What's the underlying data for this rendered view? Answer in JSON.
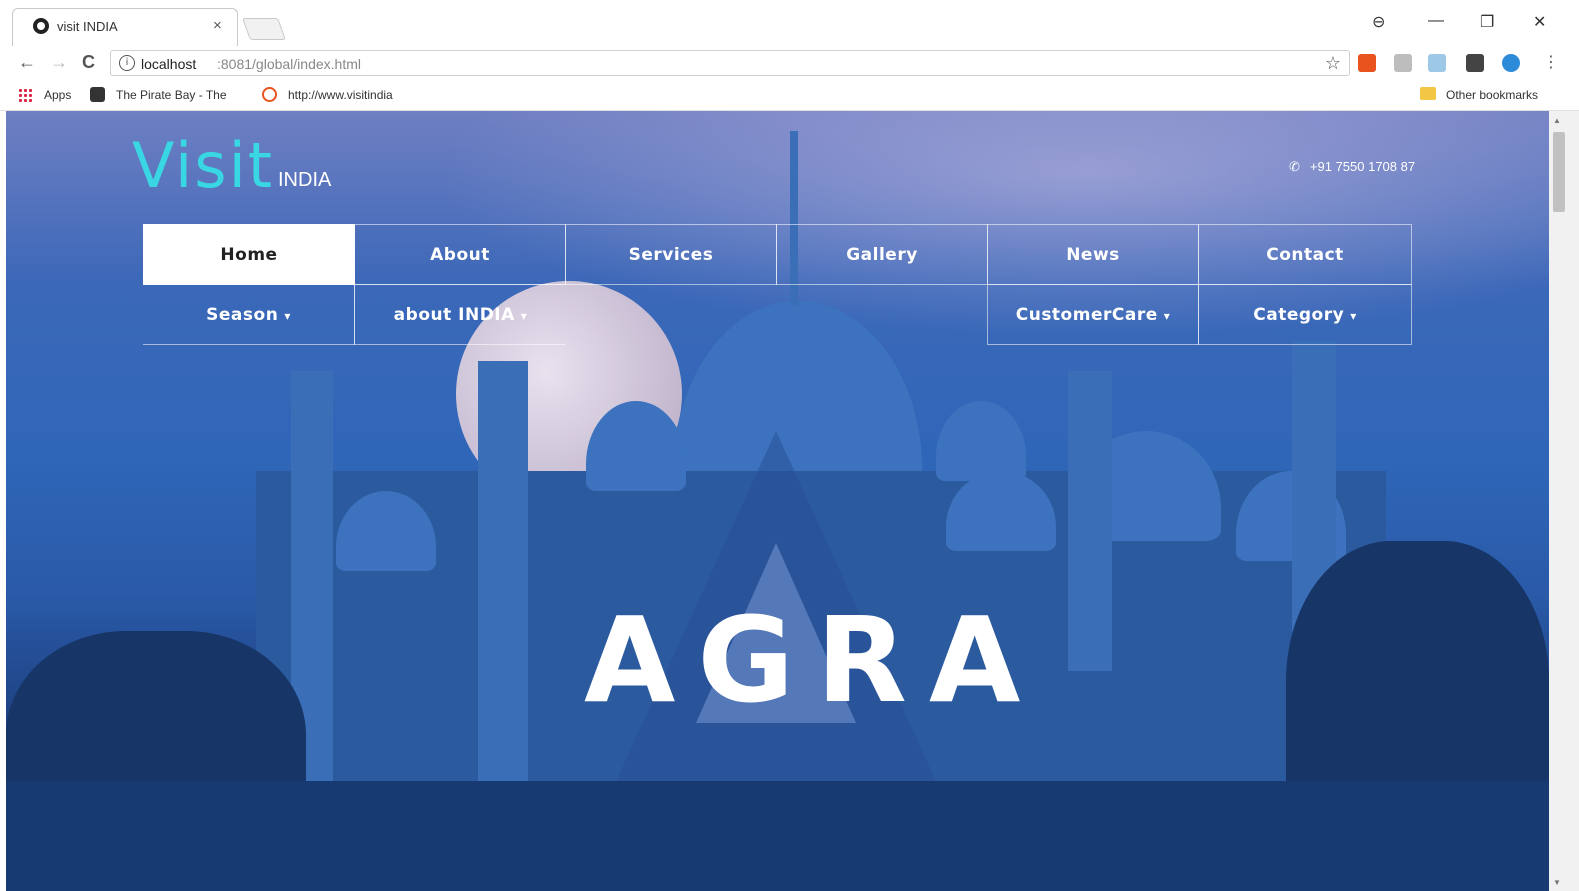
{
  "browser": {
    "tab_title": "visit INDIA",
    "tab_close": "×",
    "window_controls": {
      "account": "⊖",
      "minimize": "—",
      "restore": "❐",
      "close": "✕"
    },
    "nav": {
      "back": "←",
      "forward": "→",
      "reload": "C"
    },
    "url_host": "localhost",
    "url_path": ":8081/global/index.html",
    "star": "☆",
    "menu": "⋮",
    "bookmarks": {
      "apps": "Apps",
      "items": [
        "The Pirate Bay - The",
        "http://www.visitindia"
      ],
      "other": "Other bookmarks"
    }
  },
  "site": {
    "logo": {
      "visit": "Visit",
      "india": "INDIA"
    },
    "phone": "+91 7550 1708 87",
    "phone_icon": "phone-icon",
    "nav_row1": [
      "Home",
      "About",
      "Services",
      "Gallery",
      "News",
      "Contact"
    ],
    "nav_row2": [
      {
        "label": "Season",
        "caret": "▾"
      },
      {
        "label": "about INDIA",
        "caret": "▾"
      },
      {
        "label": "CustomerCare",
        "caret": "▾"
      },
      {
        "label": "Category",
        "caret": "▾"
      }
    ],
    "active_item": "Home",
    "hero_title": "AGRA"
  },
  "colors": {
    "logo_accent": "#39d7e3",
    "sky": "#2f66b8",
    "nav_active_bg": "#ffffff"
  }
}
